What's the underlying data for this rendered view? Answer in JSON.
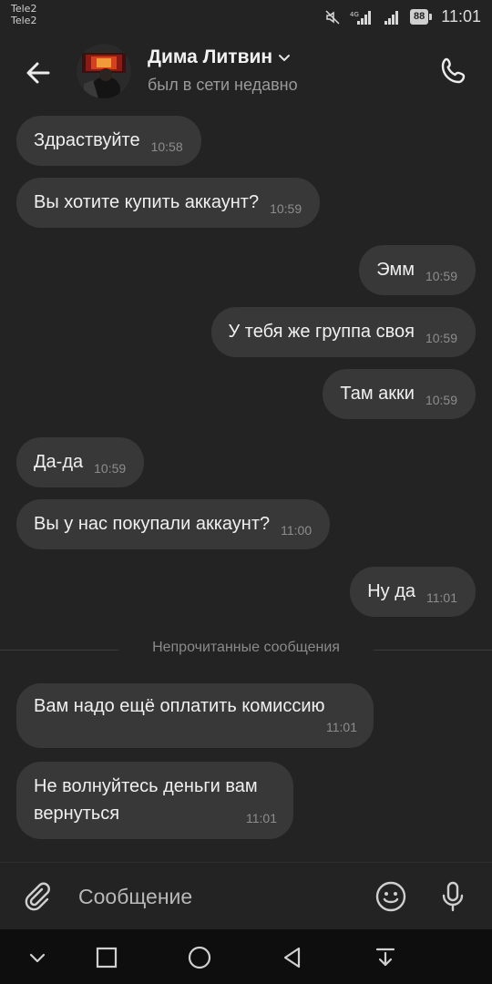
{
  "status_bar": {
    "carrier_1": "Tele2",
    "carrier_2": "Tele2",
    "network": "4G",
    "battery": "88",
    "time": "11:01"
  },
  "header": {
    "contact_name": "Дима Литвин",
    "contact_status": "был в сети недавно"
  },
  "messages": [
    {
      "side": "in",
      "text": "Здраствуйте",
      "time": "10:58"
    },
    {
      "side": "in",
      "text": "Вы хотите купить аккаунт?",
      "time": "10:59"
    },
    {
      "side": "out",
      "text": "Эмм",
      "time": "10:59"
    },
    {
      "side": "out",
      "text": "У тебя же группа своя",
      "time": "10:59"
    },
    {
      "side": "out",
      "text": "Там акки",
      "time": "10:59"
    },
    {
      "side": "in",
      "text": "Да-да",
      "time": "10:59"
    },
    {
      "side": "in",
      "text": "Вы у нас покупали аккаунт?",
      "time": "11:00"
    },
    {
      "side": "out",
      "text": "Ну да",
      "time": "11:01"
    },
    {
      "side": "in",
      "text": "Вам надо ещё оплатить комиссию",
      "time": "11:01"
    },
    {
      "side": "in",
      "text": "Не волнуйтесь деньги вам вернуться",
      "time": "11:01"
    }
  ],
  "unread_divider": "Непрочитанные сообщения",
  "composer": {
    "placeholder": "Сообщение"
  },
  "icons": {
    "back": "arrow-left",
    "call": "phone",
    "attach": "paperclip",
    "emoji": "smiley",
    "mic": "microphone"
  },
  "colors": {
    "background": "#232323",
    "bubble": "#383838",
    "nav_bar": "#0e0e0e"
  }
}
